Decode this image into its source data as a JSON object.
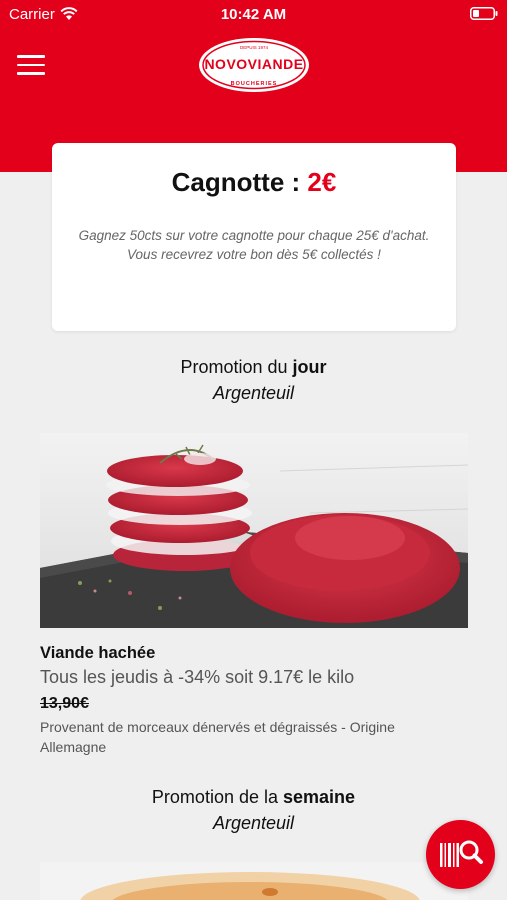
{
  "status_bar": {
    "carrier": "Carrier",
    "time": "10:42 AM"
  },
  "header": {
    "logo_text": "NOVOVIANDE",
    "logo_tagline": "BOUCHERIES",
    "logo_since": "DEPUIS 1974",
    "brand_color": "#e3001b"
  },
  "cagnotte": {
    "label": "Cagnotte :",
    "amount": "2€",
    "description_line1": "Gagnez 50cts sur votre cagnotte pour chaque 25€ d'achat.",
    "description_line2": "Vous recevrez votre bon dès 5€ collectés !"
  },
  "promo_day": {
    "title_prefix": "Promotion du",
    "title_bold": "jour",
    "store": "Argenteuil",
    "product": {
      "name": "Viande hachée",
      "offer": "Tous les jeudis à -34% soit 9.17€ le kilo",
      "old_price": "13,90€",
      "description": "Provenant de morceaux dénervés et dégraissés - Origine Allemagne"
    }
  },
  "promo_week": {
    "title_prefix": "Promotion de la",
    "title_bold": "semaine",
    "store": "Argenteuil"
  },
  "fab": {
    "icon": "barcode-search-icon"
  }
}
